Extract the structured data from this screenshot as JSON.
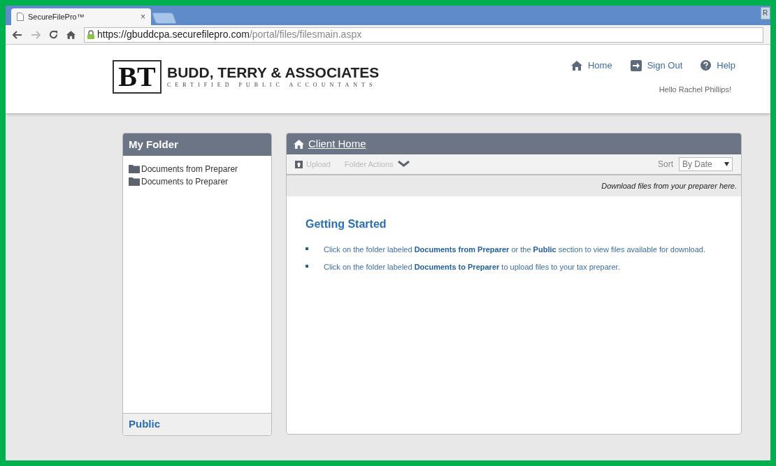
{
  "browser": {
    "tab_title": "SecureFilePro™",
    "tab_close": "×",
    "profile_button": "R",
    "url_host": "https://gbuddcpa.securefilepro.com",
    "url_path": "/portal/files/filesmain.aspx"
  },
  "header": {
    "logo_mark": "BT",
    "firm_name": "BUDD, TERRY & ASSOCIATES",
    "firm_tagline": "CERTIFIED PUBLIC ACCOUNTANTS",
    "nav": [
      {
        "kind": "home",
        "label": "Home"
      },
      {
        "kind": "signout",
        "label": "Sign Out"
      },
      {
        "kind": "help",
        "label": "Help"
      }
    ],
    "greeting": "Hello Rachel Phillips!"
  },
  "sidebar": {
    "title": "My Folder",
    "items": [
      {
        "label": "Documents from Preparer"
      },
      {
        "label": "Documents to Preparer"
      }
    ],
    "footer": "Public"
  },
  "main": {
    "title": "Client Home",
    "toolbar": {
      "upload": "Upload",
      "folder_actions": "Folder Actions",
      "sort_label": "Sort",
      "sort_value": "By Date"
    },
    "info": "Download files from your preparer here.",
    "heading": "Getting Started",
    "bullets": [
      "Click on the folder labeled **Documents from Preparer** or the **Public** section to view files available for download.",
      "Click on the folder labeled **Documents to Preparer** to upload files to your tax preparer."
    ]
  }
}
